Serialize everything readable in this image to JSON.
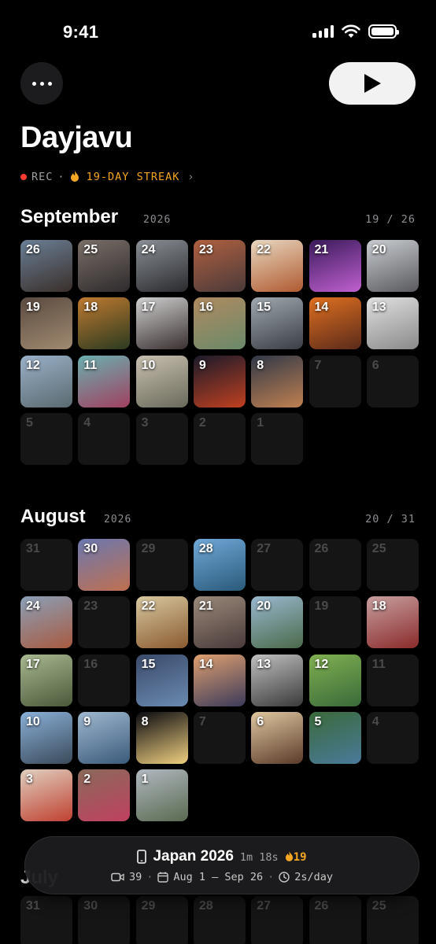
{
  "status": {
    "time": "9:41"
  },
  "header": {
    "title": "Dayjavu",
    "rec_label": "REC",
    "separator": "·",
    "streak_label": "19-DAY STREAK"
  },
  "months": [
    {
      "name": "September",
      "year": "2026",
      "count": "19 / 26",
      "days": [
        {
          "d": "26",
          "photo": true,
          "c1": "#6a7f96",
          "c2": "#3a2f2a"
        },
        {
          "d": "25",
          "photo": true,
          "c1": "#7a6f68",
          "c2": "#2e2a2c"
        },
        {
          "d": "24",
          "photo": true,
          "c1": "#8a9096",
          "c2": "#2a2a2e"
        },
        {
          "d": "23",
          "photo": true,
          "c1": "#b06040",
          "c2": "#4a3a3a"
        },
        {
          "d": "22",
          "photo": true,
          "c1": "#e8d8c0",
          "c2": "#b05a30"
        },
        {
          "d": "21",
          "photo": true,
          "c1": "#3a1a5a",
          "c2": "#c060d0"
        },
        {
          "d": "20",
          "photo": true,
          "c1": "#c8ccd0",
          "c2": "#5a5a5e"
        },
        {
          "d": "19",
          "photo": true,
          "c1": "#5a4a40",
          "c2": "#a08a70"
        },
        {
          "d": "18",
          "photo": true,
          "c1": "#c07a30",
          "c2": "#2a3a20"
        },
        {
          "d": "17",
          "photo": true,
          "c1": "#d0d0d0",
          "c2": "#3a3030"
        },
        {
          "d": "16",
          "photo": true,
          "c1": "#b08a60",
          "c2": "#6a8a6a"
        },
        {
          "d": "15",
          "photo": true,
          "c1": "#a0a8b0",
          "c2": "#3a3e44"
        },
        {
          "d": "14",
          "photo": true,
          "c1": "#e07020",
          "c2": "#5a2a1a"
        },
        {
          "d": "13",
          "photo": true,
          "c1": "#e0e0e0",
          "c2": "#8a8a8a"
        },
        {
          "d": "12",
          "photo": true,
          "c1": "#9ab0c8",
          "c2": "#5a6a70"
        },
        {
          "d": "11",
          "photo": true,
          "c1": "#6ab0b0",
          "c2": "#a04060"
        },
        {
          "d": "10",
          "photo": true,
          "c1": "#c8c0b0",
          "c2": "#6a6a5a"
        },
        {
          "d": "9",
          "photo": true,
          "c1": "#1a1a2a",
          "c2": "#c04020"
        },
        {
          "d": "8",
          "photo": true,
          "c1": "#303848",
          "c2": "#c08050"
        },
        {
          "d": "7",
          "photo": false
        },
        {
          "d": "6",
          "photo": false
        },
        {
          "d": "5",
          "photo": false
        },
        {
          "d": "4",
          "photo": false
        },
        {
          "d": "3",
          "photo": false
        },
        {
          "d": "2",
          "photo": false
        },
        {
          "d": "1",
          "photo": false
        }
      ]
    },
    {
      "name": "August",
      "year": "2026",
      "count": "20 / 31",
      "days": [
        {
          "d": "31",
          "photo": false
        },
        {
          "d": "30",
          "photo": true,
          "c1": "#6a78b0",
          "c2": "#c07050"
        },
        {
          "d": "29",
          "photo": false
        },
        {
          "d": "28",
          "photo": true,
          "c1": "#70a8d8",
          "c2": "#2a5a7a"
        },
        {
          "d": "27",
          "photo": false
        },
        {
          "d": "26",
          "photo": false
        },
        {
          "d": "25",
          "photo": false
        },
        {
          "d": "24",
          "photo": true,
          "c1": "#8aa0b8",
          "c2": "#a85a40"
        },
        {
          "d": "23",
          "photo": false
        },
        {
          "d": "22",
          "photo": true,
          "c1": "#d8c8a0",
          "c2": "#8a5a30"
        },
        {
          "d": "21",
          "photo": true,
          "c1": "#9a8a7a",
          "c2": "#4a3a3a"
        },
        {
          "d": "20",
          "photo": true,
          "c1": "#9ab8d0",
          "c2": "#4a6a4a"
        },
        {
          "d": "19",
          "photo": false
        },
        {
          "d": "18",
          "photo": true,
          "c1": "#c8a0a0",
          "c2": "#8a2a2a"
        },
        {
          "d": "17",
          "photo": true,
          "c1": "#a8b890",
          "c2": "#4a5a3a"
        },
        {
          "d": "16",
          "photo": false
        },
        {
          "d": "15",
          "photo": true,
          "c1": "#3a4a6a",
          "c2": "#6a8ab0"
        },
        {
          "d": "14",
          "photo": true,
          "c1": "#e0a070",
          "c2": "#3a3a5a"
        },
        {
          "d": "13",
          "photo": true,
          "c1": "#c0c0c0",
          "c2": "#3a3a3a"
        },
        {
          "d": "12",
          "photo": true,
          "c1": "#80b050",
          "c2": "#3a6a3a"
        },
        {
          "d": "11",
          "photo": false
        },
        {
          "d": "10",
          "photo": true,
          "c1": "#8ab0d8",
          "c2": "#3a4a5a"
        },
        {
          "d": "9",
          "photo": true,
          "c1": "#a0b8d0",
          "c2": "#3a5a7a"
        },
        {
          "d": "8",
          "photo": true,
          "c1": "#0a0a10",
          "c2": "#f0d080"
        },
        {
          "d": "7",
          "photo": false
        },
        {
          "d": "6",
          "photo": true,
          "c1": "#e0c8a0",
          "c2": "#5a3a2a"
        },
        {
          "d": "5",
          "photo": true,
          "c1": "#3a6a3a",
          "c2": "#4a7a9a"
        },
        {
          "d": "4",
          "photo": false
        },
        {
          "d": "3",
          "photo": true,
          "c1": "#e0d0c0",
          "c2": "#c04030"
        },
        {
          "d": "2",
          "photo": true,
          "c1": "#8a6a5a",
          "c2": "#c04060"
        },
        {
          "d": "1",
          "photo": true,
          "c1": "#b0b8c0",
          "c2": "#5a6a50"
        }
      ]
    },
    {
      "name": "July",
      "year": "",
      "count": "",
      "days": [
        {
          "d": "31",
          "photo": false
        },
        {
          "d": "30",
          "photo": false
        },
        {
          "d": "29",
          "photo": false
        },
        {
          "d": "28",
          "photo": false
        },
        {
          "d": "27",
          "photo": false
        },
        {
          "d": "26",
          "photo": false
        },
        {
          "d": "25",
          "photo": false
        }
      ]
    }
  ],
  "pill": {
    "title": "Japan 2026",
    "duration": "1m 18s",
    "streak": "19",
    "clips": "39",
    "date_range": "Aug 1 — Sep 26",
    "rate": "2s/day",
    "separator": "·"
  },
  "colors": {
    "accent": "#f5a623",
    "rec": "#ff3b30",
    "background": "#000000",
    "empty_cell": "#151515"
  },
  "icons": [
    "ellipsis-icon",
    "play-icon",
    "flame-icon",
    "phone-icon",
    "video-icon",
    "calendar-icon",
    "clock-icon",
    "chevron-right-icon"
  ]
}
